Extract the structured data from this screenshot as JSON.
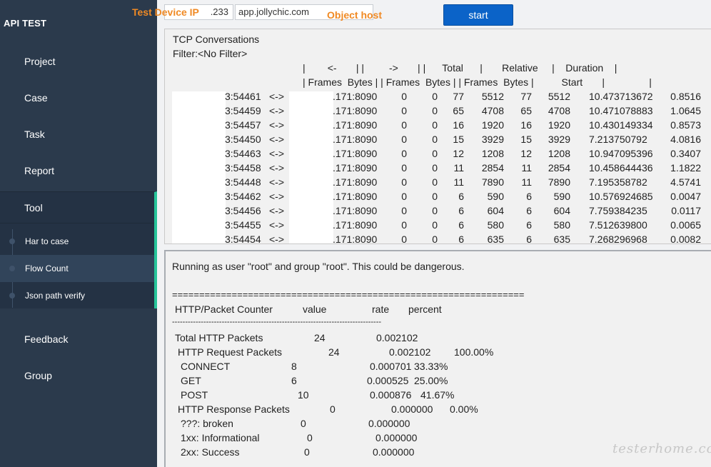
{
  "sidebar": {
    "brand": "API TEST",
    "items": [
      {
        "label": "Project"
      },
      {
        "label": "Case"
      },
      {
        "label": "Task"
      },
      {
        "label": "Report"
      }
    ],
    "tool": {
      "label": "Tool",
      "sub_items": [
        {
          "label": "Har to case"
        },
        {
          "label": "Flow Count"
        },
        {
          "label": "Json path verify"
        }
      ]
    },
    "bottom_items": [
      {
        "label": "Feedback"
      },
      {
        "label": "Group"
      }
    ]
  },
  "topbar": {
    "device_ip_label": "Test Device IP",
    "device_ip_value": ".233",
    "host_value": "app.jollychic.com",
    "host_label": "Object host",
    "start_label": "start"
  },
  "tcp": {
    "title": "TCP Conversations",
    "filter": "Filter:<No Filter>",
    "header1": "|        <-       | |         ->       | |      Total      |       Relative     |    Duration    |",
    "header2": "| Frames  Bytes | | Frames  Bytes | | Frames  Bytes |          Start       |                |",
    "rows": [
      {
        "src": "3:54461",
        "arrow": "<->",
        "dst": ".171:8090",
        "f1": "0",
        "b1": "0",
        "tf": "77",
        "tb": "5512",
        "f2": "77",
        "b2": "5512",
        "start": "10.473713672",
        "dur": "0.8516"
      },
      {
        "src": "3:54459",
        "arrow": "<->",
        "dst": ".171:8090",
        "f1": "0",
        "b1": "0",
        "tf": "65",
        "tb": "4708",
        "f2": "65",
        "b2": "4708",
        "start": "10.471078883",
        "dur": "1.0645"
      },
      {
        "src": "3:54457",
        "arrow": "<->",
        "dst": ".171:8090",
        "f1": "0",
        "b1": "0",
        "tf": "16",
        "tb": "1920",
        "f2": "16",
        "b2": "1920",
        "start": "10.430149334",
        "dur": "0.8573"
      },
      {
        "src": "3:54450",
        "arrow": "<->",
        "dst": ".171:8090",
        "f1": "0",
        "b1": "0",
        "tf": "15",
        "tb": "3929",
        "f2": "15",
        "b2": "3929",
        "start": "7.213750792",
        "dur": "4.0816"
      },
      {
        "src": "3:54463",
        "arrow": "<->",
        "dst": ".171:8090",
        "f1": "0",
        "b1": "0",
        "tf": "12",
        "tb": "1208",
        "f2": "12",
        "b2": "1208",
        "start": "10.947095396",
        "dur": "0.3407"
      },
      {
        "src": "3:54458",
        "arrow": "<->",
        "dst": ".171:8090",
        "f1": "0",
        "b1": "0",
        "tf": "11",
        "tb": "2854",
        "f2": "11",
        "b2": "2854",
        "start": "10.458644436",
        "dur": "1.1822"
      },
      {
        "src": "3:54448",
        "arrow": "<->",
        "dst": ".171:8090",
        "f1": "0",
        "b1": "0",
        "tf": "11",
        "tb": "7890",
        "f2": "11",
        "b2": "7890",
        "start": "7.195358782",
        "dur": "4.5741"
      },
      {
        "src": "3:54462",
        "arrow": "<->",
        "dst": ".171:8090",
        "f1": "0",
        "b1": "0",
        "tf": "6",
        "tb": "590",
        "f2": "6",
        "b2": "590",
        "start": "10.576924685",
        "dur": "0.0047"
      },
      {
        "src": "3:54456",
        "arrow": "<->",
        "dst": ".171:8090",
        "f1": "0",
        "b1": "0",
        "tf": "6",
        "tb": "604",
        "f2": "6",
        "b2": "604",
        "start": "7.759384235",
        "dur": "0.0117"
      },
      {
        "src": "3:54455",
        "arrow": "<->",
        "dst": ".171:8090",
        "f1": "0",
        "b1": "0",
        "tf": "6",
        "tb": "580",
        "f2": "6",
        "b2": "580",
        "start": "7.512639800",
        "dur": "0.0065"
      },
      {
        "src": "3:54454",
        "arrow": "<->",
        "dst": ".171:8090",
        "f1": "0",
        "b1": "0",
        "tf": "6",
        "tb": "635",
        "f2": "6",
        "b2": "635",
        "start": "7.268296968",
        "dur": "0.0082"
      }
    ]
  },
  "http": {
    "warning": "Running as user \"root\" and group \"root\". This could be dangerous.",
    "separator_eq": "=================================================================",
    "header": {
      "col1": "HTTP/Packet Counter",
      "col2": "value",
      "col3": "rate",
      "col4": "percent"
    },
    "separator_dash": "--------------------------------------------------------------------------------",
    "rows": [
      {
        "label": "Total HTTP Packets",
        "value": "24",
        "rate": "0.002102",
        "percent": ""
      },
      {
        "label": "HTTP Request Packets",
        "value": "24",
        "rate": "0.002102",
        "percent": "100.00%"
      },
      {
        "label": "CONNECT",
        "value": "8",
        "rate": "0.000701",
        "percent": "33.33%"
      },
      {
        "label": "GET",
        "value": "6",
        "rate": "0.000525",
        "percent": "25.00%"
      },
      {
        "label": "POST",
        "value": "10",
        "rate": "0.000876",
        "percent": "41.67%"
      },
      {
        "label": "HTTP Response Packets",
        "value": "0",
        "rate": "0.000000",
        "percent": "0.00%"
      },
      {
        "label": "???: broken",
        "value": "0",
        "rate": "0.000000",
        "percent": ""
      },
      {
        "label": "1xx: Informational",
        "value": "0",
        "rate": "0.000000",
        "percent": ""
      },
      {
        "label": "2xx: Success",
        "value": "0",
        "rate": "0.000000",
        "percent": ""
      }
    ]
  },
  "watermark": "testerhome.com"
}
